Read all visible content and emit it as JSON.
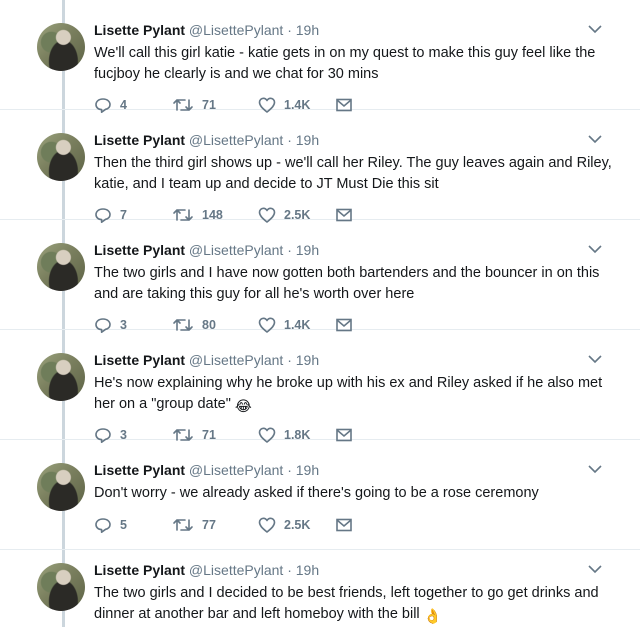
{
  "tweets": [
    {
      "name": "Lisette Pylant",
      "handle": "@LisettePylant",
      "dot": "·",
      "time": "19h",
      "text": "We'll call this girl katie - katie gets in on my quest to make this guy feel like the fucjboy he clearly is and we chat for 30 mins",
      "emoji": "",
      "replies": "4",
      "retweets": "71",
      "likes": "1.4K"
    },
    {
      "name": "Lisette Pylant",
      "handle": "@LisettePylant",
      "dot": "·",
      "time": "19h",
      "text": "Then the third girl shows up - we'll call her Riley. The guy leaves again and Riley, katie, and I team up and decide to JT Must Die this sit",
      "emoji": "",
      "replies": "7",
      "retweets": "148",
      "likes": "2.5K"
    },
    {
      "name": "Lisette Pylant",
      "handle": "@LisettePylant",
      "dot": "·",
      "time": "19h",
      "text": "The two girls and I have now gotten both bartenders and the bouncer in on this and are taking this guy for all he's worth over here",
      "emoji": "",
      "replies": "3",
      "retweets": "80",
      "likes": "1.4K"
    },
    {
      "name": "Lisette Pylant",
      "handle": "@LisettePylant",
      "dot": "·",
      "time": "19h",
      "text": "He's now explaining why he broke up with his ex and Riley asked if he also met her on a \"group date\"",
      "emoji": "😂",
      "replies": "3",
      "retweets": "71",
      "likes": "1.8K"
    },
    {
      "name": "Lisette Pylant",
      "handle": "@LisettePylant",
      "dot": "·",
      "time": "19h",
      "text": "Don't worry - we already asked if there's going to be a rose ceremony",
      "emoji": "",
      "replies": "5",
      "retweets": "77",
      "likes": "2.5K"
    },
    {
      "name": "Lisette Pylant",
      "handle": "@LisettePylant",
      "dot": "·",
      "time": "19h",
      "text": "The two girls and I decided to be best friends, left together to go get drinks and dinner at another bar and left homeboy with the bill",
      "emoji": "👌",
      "replies": "",
      "retweets": "",
      "likes": ""
    }
  ],
  "icons": {
    "reply": "reply-icon",
    "retweet": "retweet-icon",
    "like": "heart-icon",
    "dm": "envelope-icon",
    "caret": "chevron-down-icon"
  },
  "colors": {
    "icon_gray": "#657786",
    "thread_line": "#ccd6dd",
    "divider": "#e6ecf0"
  }
}
